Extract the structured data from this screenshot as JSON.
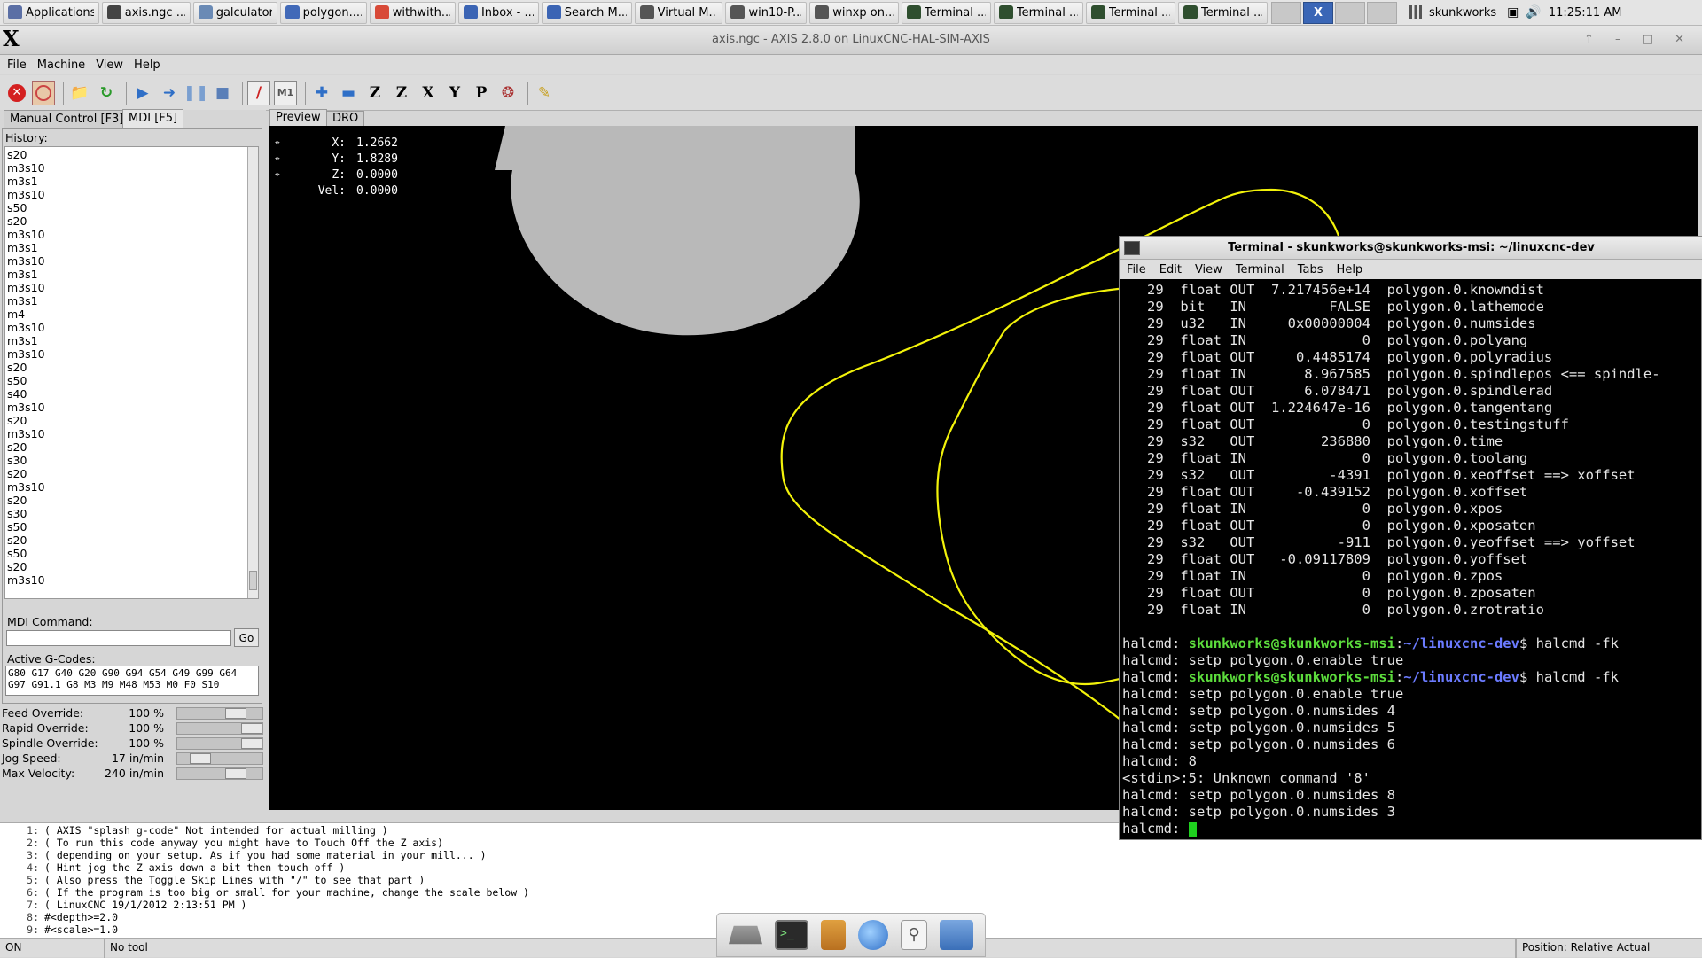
{
  "taskbar": {
    "items": [
      {
        "label": "Applications",
        "color": "#5b6fa5"
      },
      {
        "label": "axis.ngc ...",
        "color": "#444444"
      },
      {
        "label": "galculator",
        "color": "#6a8ab5"
      },
      {
        "label": "polygon....",
        "color": "#4169b8"
      },
      {
        "label": "withwith...",
        "color": "#d84a38"
      },
      {
        "label": "Inbox - ...",
        "color": "#3b64b4"
      },
      {
        "label": "Search M...",
        "color": "#3b64b4"
      },
      {
        "label": "Virtual M...",
        "color": "#555555"
      },
      {
        "label": "win10-P...",
        "color": "#555555"
      },
      {
        "label": "winxp on...",
        "color": "#555555"
      },
      {
        "label": "Terminal ...",
        "color": "#2f4f2f"
      },
      {
        "label": "Terminal ...",
        "color": "#2f4f2f"
      },
      {
        "label": "Terminal ...",
        "color": "#2f4f2f"
      },
      {
        "label": "Terminal ...",
        "color": "#2f4f2f"
      }
    ],
    "user": "skunkworks",
    "time": "11:25:11 AM"
  },
  "window": {
    "icon": "X",
    "title": "axis.ngc - AXIS 2.8.0 on LinuxCNC-HAL-SIM-AXIS"
  },
  "menu": [
    "File",
    "Machine",
    "View",
    "Help"
  ],
  "tabs": {
    "manual": "Manual Control [F3]",
    "mdi": "MDI [F5]",
    "preview": "Preview",
    "dro": "DRO"
  },
  "history": {
    "label": "History:",
    "items": [
      "s20",
      "m3s10",
      "m3s1",
      "m3s10",
      "s50",
      "s20",
      "m3s10",
      "m3s1",
      "m3s10",
      "m3s1",
      "m3s10",
      "m3s1",
      "m4",
      "m3s10",
      "m3s1",
      "m3s10",
      "s20",
      "s50",
      "s40",
      "m3s10",
      "s20",
      "m3s10",
      "s20",
      "s30",
      "s20",
      "m3s10",
      "s20",
      "s30",
      "s50",
      "s20",
      "s50",
      "s20",
      "m3s10"
    ]
  },
  "mdi": {
    "label": "MDI Command:",
    "value": "",
    "go": "Go"
  },
  "gcodes": {
    "label": "Active G-Codes:",
    "line1": "G80 G17 G40 G20 G90 G94 G54 G49 G99 G64",
    "line2": "G97 G91.1 G8 M3 M9 M48 M53 M0 F0 S10"
  },
  "overrides": [
    {
      "name": "Feed Override:",
      "value": "100 %",
      "level": 0.75
    },
    {
      "name": "Rapid Override:",
      "value": "100 %",
      "level": 1.0
    },
    {
      "name": "Spindle Override:",
      "value": "100 %",
      "level": 1.0
    },
    {
      "name": "Jog Speed:",
      "value": "17 in/min",
      "level": 0.2
    },
    {
      "name": "Max Velocity:",
      "value": "240 in/min",
      "level": 0.75
    }
  ],
  "dro": [
    {
      "label": "X:",
      "value": "1.2662"
    },
    {
      "label": "Y:",
      "value": "1.8289"
    },
    {
      "label": "Z:",
      "value": "0.0000"
    },
    {
      "label": "Vel:",
      "value": "0.0000"
    }
  ],
  "gcode_lines": [
    {
      "n": "1:",
      "text": "( AXIS \"splash g-code\" Not intended for actual milling )"
    },
    {
      "n": "2:",
      "text": "( To run this code anyway you might have to Touch Off the Z axis)"
    },
    {
      "n": "3:",
      "text": "( depending on your setup. As if you had some material in your mill... )"
    },
    {
      "n": "4:",
      "text": "( Hint jog the Z axis down a bit then touch off )"
    },
    {
      "n": "5:",
      "text": "( Also press the Toggle Skip Lines with \"/\" to see that part )"
    },
    {
      "n": "6:",
      "text": "( If the program is too big or small for your machine, change the scale below )"
    },
    {
      "n": "7:",
      "text": "( LinuxCNC 19/1/2012 2:13:51 PM )"
    },
    {
      "n": "8:",
      "text": "#<depth>=2.0"
    },
    {
      "n": "9:",
      "text": "#<scale>=1.0"
    }
  ],
  "status": {
    "state": "ON",
    "tool": "No tool",
    "position": "Position: Relative Actual"
  },
  "terminal": {
    "title": "Terminal - skunkworks@skunkworks-msi: ~/linuxcnc-dev",
    "menu": [
      "File",
      "Edit",
      "View",
      "Terminal",
      "Tabs",
      "Help"
    ],
    "pins": [
      "   29  float OUT  7.217456e+14  polygon.0.knowndist",
      "   29  bit   IN          FALSE  polygon.0.lathemode",
      "   29  u32   IN     0x00000004  polygon.0.numsides",
      "   29  float IN              0  polygon.0.polyang",
      "   29  float OUT     0.4485174  polygon.0.polyradius",
      "   29  float IN       8.967585  polygon.0.spindlepos <== spindle-",
      "   29  float OUT      6.078471  polygon.0.spindlerad",
      "   29  float OUT  1.224647e-16  polygon.0.tangentang",
      "   29  float OUT             0  polygon.0.testingstuff",
      "   29  s32   OUT        236880  polygon.0.time",
      "   29  float IN              0  polygon.0.toolang",
      "   29  s32   OUT         -4391  polygon.0.xeoffset ==> xoffset",
      "   29  float OUT     -0.439152  polygon.0.xoffset",
      "   29  float IN              0  polygon.0.xpos",
      "   29  float OUT             0  polygon.0.xposaten",
      "   29  s32   OUT          -911  polygon.0.yeoffset ==> yoffset",
      "   29  float OUT   -0.09117809  polygon.0.yoffset",
      "   29  float IN              0  polygon.0.zpos",
      "   29  float OUT             0  polygon.0.zposaten",
      "   29  float IN              0  polygon.0.zrotratio"
    ],
    "prompt_halcmd": "halcmd:",
    "prompt_user": "skunkworks@skunkworks-msi",
    "prompt_path": "~/linuxcnc-dev",
    "prompt_cmd": "$ halcmd -fk",
    "session": [
      "halcmd: setp polygon.0.enable true",
      "__PROMPT__",
      "halcmd: setp polygon.0.enable true",
      "halcmd: setp polygon.0.numsides 4",
      "halcmd: setp polygon.0.numsides 5",
      "halcmd: setp polygon.0.numsides 6",
      "halcmd: 8",
      "<stdin>:5: Unknown command '8'",
      "halcmd: setp polygon.0.numsides 8",
      "halcmd: setp polygon.0.numsides 3",
      "halcmd: "
    ]
  }
}
